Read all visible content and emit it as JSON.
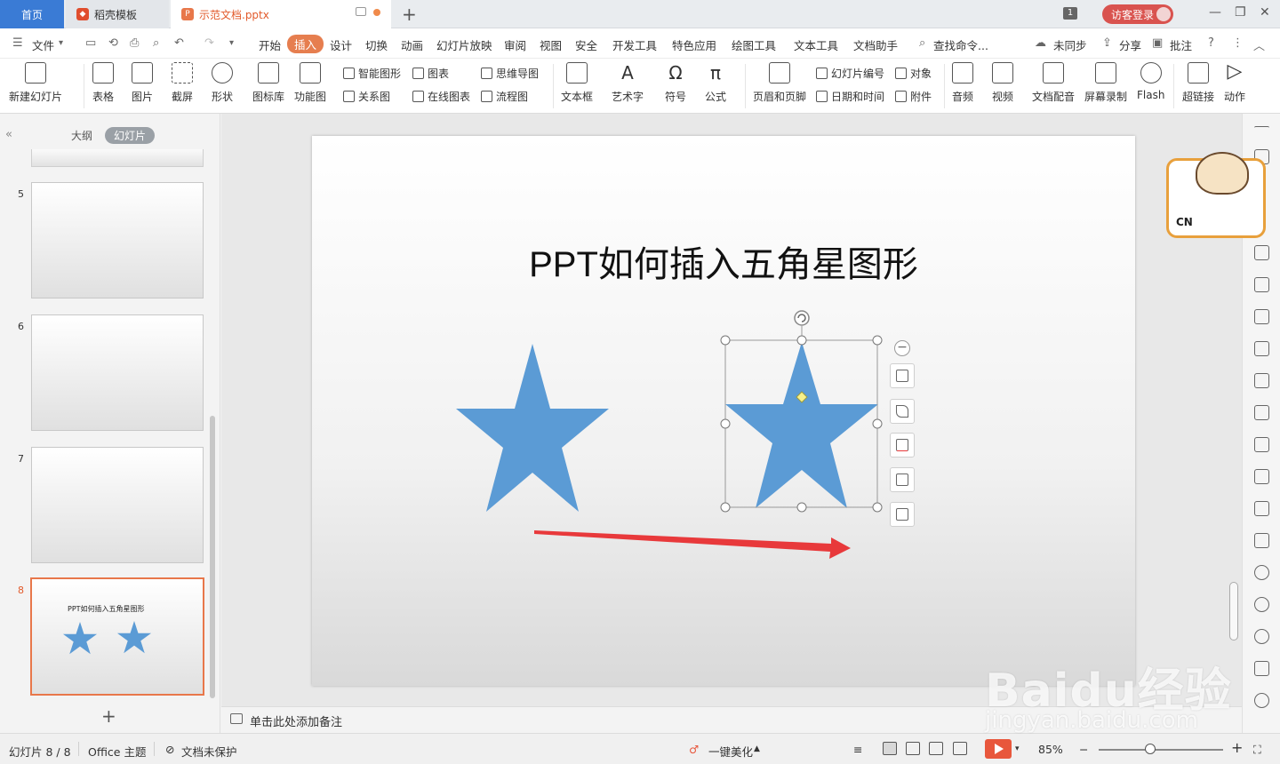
{
  "tabs": {
    "home": "首页",
    "template": "稻壳模板",
    "doc": "示范文档.pptx"
  },
  "window": {
    "badge": "1",
    "visitor_login": "访客登录"
  },
  "menu": {
    "file": "文件",
    "items": [
      "开始",
      "插入",
      "设计",
      "切换",
      "动画",
      "幻灯片放映",
      "审阅",
      "视图",
      "安全",
      "开发工具",
      "特色应用",
      "绘图工具",
      "文本工具",
      "文档助手"
    ],
    "active": "插入",
    "search": "查找命令...",
    "sync": "未同步",
    "share": "分享",
    "comment": "批注"
  },
  "ribbon": {
    "new_slide": "新建幻灯片",
    "table": "表格",
    "picture": "图片",
    "screenshot": "截屏",
    "shape": "形状",
    "icon_lib": "图标库",
    "func_chart": "功能图",
    "smart_art": "智能图形",
    "chart": "图表",
    "relation": "关系图",
    "online_chart": "在线图表",
    "mind_map": "思维导图",
    "flow_chart": "流程图",
    "textbox": "文本框",
    "wordart": "艺术字",
    "symbol": "符号",
    "formula": "公式",
    "header_footer": "页眉和页脚",
    "slide_number": "幻灯片编号",
    "object": "对象",
    "date_time": "日期和时间",
    "attachment": "附件",
    "audio": "音频",
    "video": "视频",
    "doc_voice": "文档配音",
    "screen_record": "屏幕录制",
    "flash": "Flash",
    "hyperlink": "超链接",
    "action": "动作"
  },
  "panel": {
    "outline_tab": "大纲",
    "slides_tab": "幻灯片",
    "slides": [
      {
        "num": "5"
      },
      {
        "num": "6"
      },
      {
        "num": "7"
      },
      {
        "num": "8",
        "title": "PPT如何插入五角星图形"
      }
    ]
  },
  "slide": {
    "title": "PPT如何插入五角星图形",
    "star_color": "#5b9bd5",
    "arrow_color": "#e8393b"
  },
  "mascot": {
    "label": "CN"
  },
  "notes": {
    "placeholder": "单击此处添加备注"
  },
  "status": {
    "slide_info": "幻灯片 8 / 8",
    "theme": "Office 主题",
    "protect": "文档未保护",
    "beautify": "一键美化",
    "zoom": "85%"
  },
  "watermark": {
    "brand": "Baidu经验",
    "url": "jingyan.baidu.com"
  }
}
